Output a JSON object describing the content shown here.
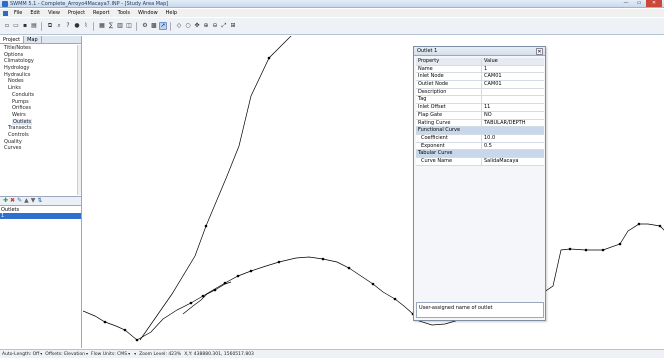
{
  "window": {
    "title": "SWMM 5.1 - Complete_Arroyo4Macaya7.INP - [Study Area Map]",
    "minimize": "—",
    "maximize": "▭",
    "close": "✕"
  },
  "menu": [
    "File",
    "Edit",
    "View",
    "Project",
    "Report",
    "Tools",
    "Window",
    "Help"
  ],
  "left_panel": {
    "tabs": [
      "Project",
      "Map"
    ],
    "tree": [
      {
        "label": "Title/Notes",
        "indent": 2
      },
      {
        "label": "Options",
        "indent": 2
      },
      {
        "label": "Climatology",
        "indent": 2
      },
      {
        "label": "Hydrology",
        "indent": 2
      },
      {
        "label": "Hydraulics",
        "indent": 2
      },
      {
        "label": "Nodes",
        "indent": 4
      },
      {
        "label": "Links",
        "indent": 4
      },
      {
        "label": "Conduits",
        "indent": 6
      },
      {
        "label": "Pumps",
        "indent": 6
      },
      {
        "label": "Orifices",
        "indent": 6
      },
      {
        "label": "Weirs",
        "indent": 6
      },
      {
        "label": "Outlets",
        "indent": 6
      },
      {
        "label": "Transects",
        "indent": 4
      },
      {
        "label": "Controls",
        "indent": 4
      },
      {
        "label": "Quality",
        "indent": 2
      },
      {
        "label": "Curves",
        "indent": 2
      }
    ],
    "selected_index": 11,
    "list_title": "Outlets",
    "list_items": [
      "1"
    ]
  },
  "property_editor": {
    "title": "Outlet 1",
    "header": {
      "property": "Property",
      "value": "Value"
    },
    "rows": [
      {
        "type": "row",
        "key": "Name",
        "value": "1"
      },
      {
        "type": "row",
        "key": "Inlet Node",
        "value": "CAM01"
      },
      {
        "type": "row",
        "key": "Outlet Node",
        "value": "CAM01"
      },
      {
        "type": "row",
        "key": "Description",
        "value": ""
      },
      {
        "type": "row",
        "key": "Tag",
        "value": ""
      },
      {
        "type": "row",
        "key": "Inlet Offset",
        "value": "11"
      },
      {
        "type": "row",
        "key": "Flap Gate",
        "value": "NO"
      },
      {
        "type": "row",
        "key": "Rating Curve",
        "value": "TABULAR/DEPTH"
      },
      {
        "type": "section",
        "key": "Functional Curve",
        "value": ""
      },
      {
        "type": "sub",
        "key": "Coefficient",
        "value": "10.0"
      },
      {
        "type": "sub",
        "key": "Exponent",
        "value": "0.5"
      },
      {
        "type": "section",
        "key": "Tabular Curve",
        "value": ""
      },
      {
        "type": "sub",
        "key": "Curve Name",
        "value": "SalidaMacaya"
      }
    ],
    "description": "User-assigned name of outlet"
  },
  "status_bar": [
    {
      "text": "Auto-Length: Off",
      "dropdown": true
    },
    {
      "text": "Offsets: Elevation",
      "dropdown": true
    },
    {
      "text": "Flow Units: CMS",
      "dropdown": true
    },
    {
      "text": "",
      "dropdown": true
    },
    {
      "text": "Zoom Level: 423%",
      "dropdown": false
    },
    {
      "text": "X,Y: 438880.301, 1560517.803",
      "dropdown": false
    }
  ],
  "colors": {
    "titlebar": "#c9d8ec",
    "selection": "#2f6fd0",
    "section_row": "#c9d7ea",
    "map_line": "#000000"
  }
}
